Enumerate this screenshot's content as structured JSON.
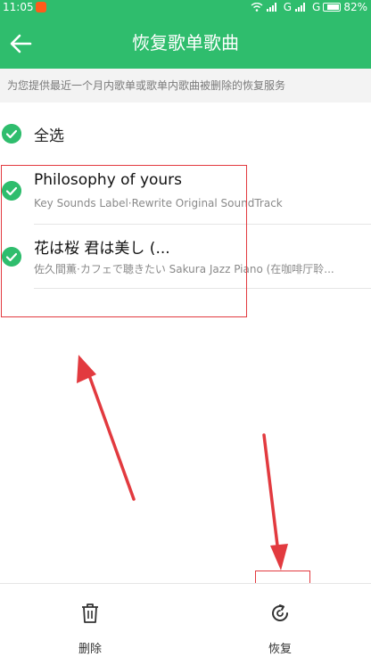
{
  "status_bar": {
    "time": "11:05",
    "network": "G",
    "network2": "G",
    "battery": "82%",
    "battery_level": 0.82
  },
  "header": {
    "title": "恢复歌单歌曲"
  },
  "notice": "为您提供最近一个月内歌单或歌单内歌曲被删除的恢复服务",
  "select_all": {
    "label": "全选"
  },
  "songs": [
    {
      "title": "Philosophy of yours",
      "subtitle": "Key Sounds Label·Rewrite Original SoundTrack"
    },
    {
      "title": "花は桜 君は美し (...",
      "subtitle": "佐久間薫·カフェで聴きたい Sakura Jazz Piano (在咖啡厅聆..."
    }
  ],
  "bottom_bar": {
    "delete_label": "删除",
    "restore_label": "恢复"
  },
  "colors": {
    "accent": "#2fbd6d",
    "annotation": "#e23a3f"
  }
}
